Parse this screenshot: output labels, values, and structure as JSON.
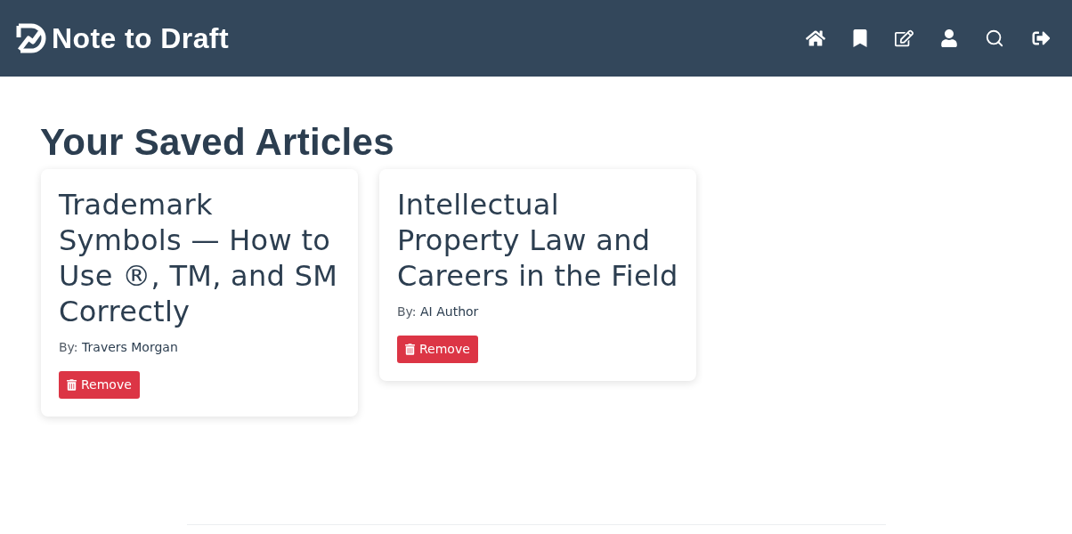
{
  "header": {
    "brand": "Note to Draft"
  },
  "page_title": "Your Saved Articles",
  "articles": [
    {
      "title": "Trademark Symbols — How to Use ®, TM, and SM Correctly",
      "by_label": "By:",
      "author": "Travers Morgan",
      "button": "Remove"
    },
    {
      "title": "Intellectual Property Law and Careers in the Field",
      "by_label": "By:",
      "author": "AI Author",
      "button": "Remove"
    }
  ]
}
